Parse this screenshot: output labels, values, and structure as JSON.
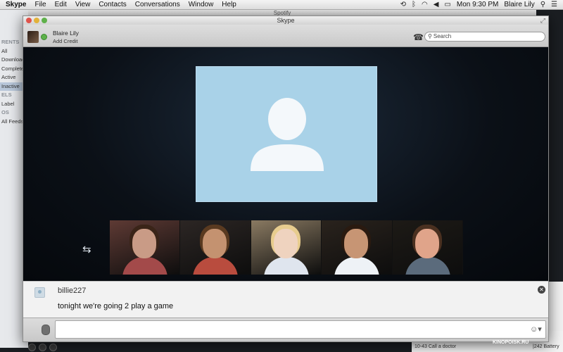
{
  "menubar": {
    "items": [
      "Skype",
      "File",
      "Edit",
      "View",
      "Contacts",
      "Conversations",
      "Window",
      "Help"
    ],
    "clock": "Mon 9:30 PM",
    "user": "Blaire Lily"
  },
  "background": {
    "spotify_title": "Spotify",
    "sidebar": [
      "RENTS",
      "All",
      "Downloading",
      "Completed",
      "Active",
      "Inactive",
      "ELS",
      "Label",
      "OS",
      "All Feeds"
    ],
    "bottom_lines": [
      "10-43 Call a doctor"
    ],
    "battery": "|242 Battery"
  },
  "skype": {
    "title": "Skype",
    "user_name": "Blaire Lily",
    "add_credit": "Add Credit",
    "search_placeholder": "Search",
    "chat": {
      "sender": "billie227",
      "message": "tonight we're going 2 play a game",
      "input_value": ""
    }
  },
  "participants": [
    {
      "skin": "#c99b86",
      "hair": "#3a2418",
      "bg": "#5e3a34",
      "shirt": "#a34a4a"
    },
    {
      "skin": "#c49270",
      "hair": "#5a3a20",
      "bg": "#2c2624",
      "shirt": "#b94c3e"
    },
    {
      "skin": "#efd3bf",
      "hair": "#e7cc8e",
      "bg": "#8a7a62",
      "shirt": "#dfe5ee"
    },
    {
      "skin": "#c79574",
      "hair": "#2a1a10",
      "bg": "#2a231d",
      "shirt": "#eef2f6"
    },
    {
      "skin": "#e0a48a",
      "hair": "#4a3020",
      "bg": "#1d1a16",
      "shirt": "#5b6b7c"
    }
  ],
  "watermark": "KINOPOISK.RU",
  "colors": {
    "video_placeholder": "#a9d2e8",
    "online": "#5db14a"
  },
  "icons": [
    "apple-icon",
    "sync-icon",
    "wifi-icon",
    "volume-icon",
    "battery-icon",
    "spotlight-icon",
    "swap-video-icon",
    "close-chat-icon",
    "dialpad-icon",
    "search-icon",
    "emoji-icon",
    "mic-icon"
  ]
}
